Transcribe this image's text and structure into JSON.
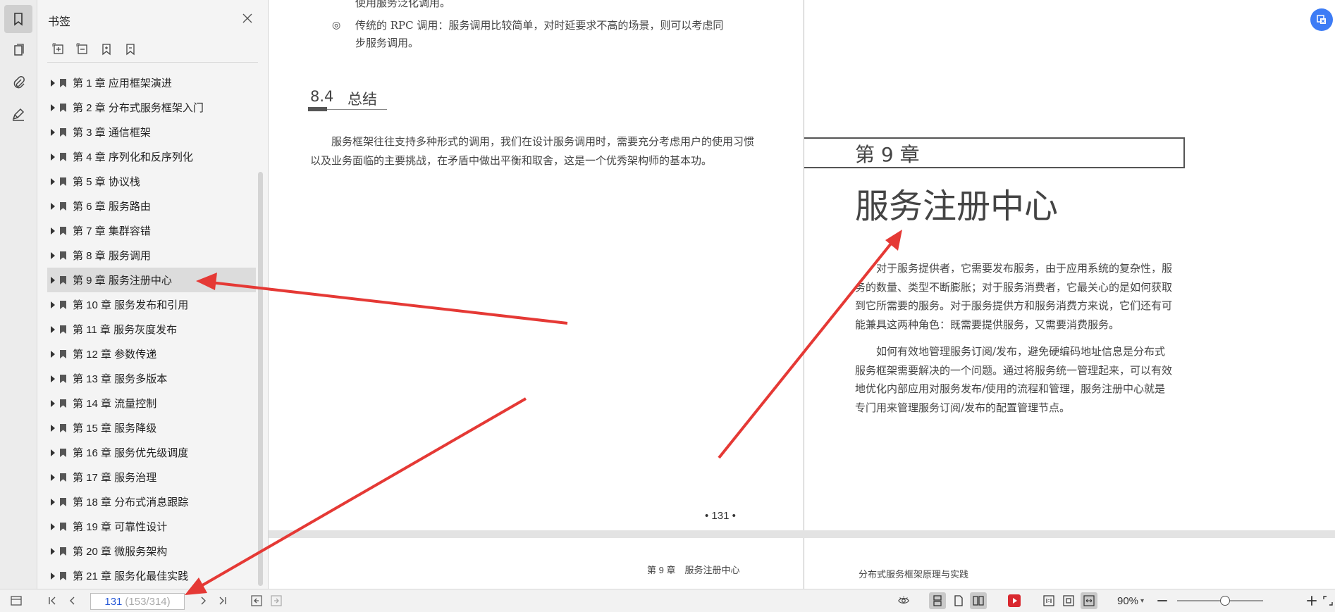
{
  "panel": {
    "title": "书签",
    "items": [
      {
        "label": "第 1 章 应用框架演进"
      },
      {
        "label": "第 2 章 分布式服务框架入门"
      },
      {
        "label": "第 3 章 通信框架"
      },
      {
        "label": "第 4 章 序列化和反序列化"
      },
      {
        "label": "第 5 章 协议栈"
      },
      {
        "label": "第 6 章 服务路由"
      },
      {
        "label": "第 7 章 集群容错"
      },
      {
        "label": "第 8 章 服务调用"
      },
      {
        "label": "第 9 章 服务注册中心",
        "selected": true
      },
      {
        "label": "第 10 章 服务发布和引用"
      },
      {
        "label": "第 11 章 服务灰度发布"
      },
      {
        "label": "第 12 章 参数传递"
      },
      {
        "label": "第 13 章 服务多版本"
      },
      {
        "label": "第 14 章 流量控制"
      },
      {
        "label": "第 15 章 服务降级"
      },
      {
        "label": "第 16 章 服务优先级调度"
      },
      {
        "label": "第 17 章 服务治理"
      },
      {
        "label": "第 18 章 分布式消息跟踪"
      },
      {
        "label": "第 19 章 可靠性设计"
      },
      {
        "label": "第 20 章 微服务架构"
      },
      {
        "label": "第 21 章 服务化最佳实践"
      }
    ]
  },
  "left_page": {
    "top_line": "使用服务泛化调用。",
    "bullet_symbol": "◎",
    "bullet_line1": "传统的 RPC 调用：服务调用比较简单，对时延要求不高的场景，则可以考虑同",
    "bullet_line2": "步服务调用。",
    "section_number": "8.4",
    "section_title": "总结",
    "paragraph": "服务框架往往支持多种形式的调用，我们在设计服务调用时，需要充分考虑用户的使用习惯以及业务面临的主要挑战，在矛盾中做出平衡和取舍，这是一个优秀架构师的基本功。",
    "page_number": "• 131 •",
    "footer": "第 9 章　服务注册中心"
  },
  "right_page": {
    "chapter_label": "第 9 章",
    "chapter_title": "服务注册中心",
    "para1": "对于服务提供者，它需要发布服务，由于应用系统的复杂性，服务的数量、类型不断膨胀；对于服务消费者，它最关心的是如何获取到它所需要的服务。对于服务提供方和服务消费方来说，它们还有可能兼具这两种角色：既需要提供服务，又需要消费服务。",
    "para2": "如何有效地管理服务订阅/发布，避免硬编码地址信息是分布式服务框架需要解决的一个问题。通过将服务统一管理起来，可以有效地优化内部应用对服务发布/使用的流程和管理，服务注册中心就是专门用来管理服务订阅/发布的配置管理节点。",
    "footer": "分布式服务框架原理与实践"
  },
  "status": {
    "current_page": "131",
    "page_total": "(153/314)",
    "zoom": "90%",
    "zoom_level": 0.55
  },
  "colors": {
    "annotation_arrow": "#e53935",
    "accent": "#3d7cf5",
    "present_button": "#d9282f"
  }
}
